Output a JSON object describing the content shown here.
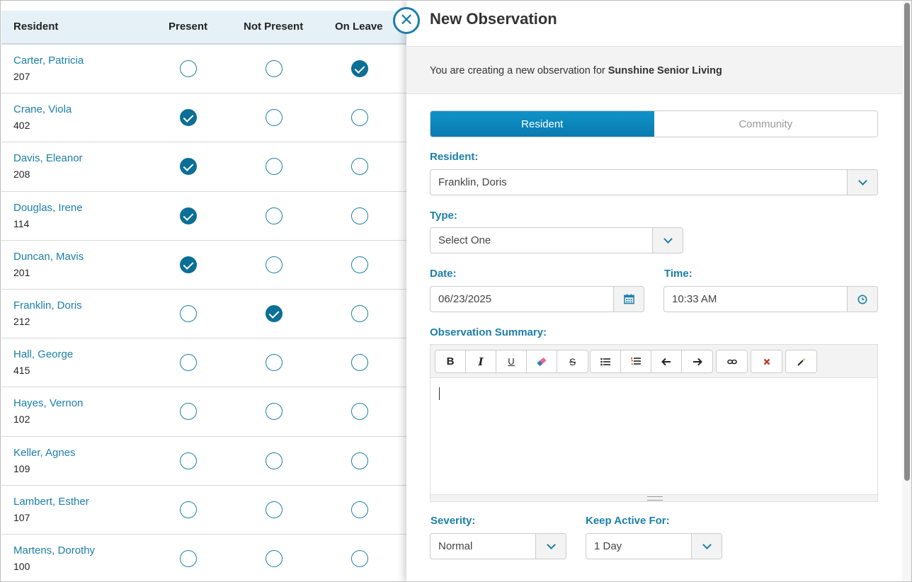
{
  "table": {
    "headers": {
      "resident": "Resident",
      "present": "Present",
      "not_present": "Not Present",
      "on_leave": "On Leave"
    },
    "rows": [
      {
        "name": "Carter, Patricia",
        "room": "207",
        "status": "on_leave"
      },
      {
        "name": "Crane, Viola",
        "room": "402",
        "status": "present"
      },
      {
        "name": "Davis, Eleanor",
        "room": "208",
        "status": "present"
      },
      {
        "name": "Douglas, Irene",
        "room": "114",
        "status": "present"
      },
      {
        "name": "Duncan, Mavis",
        "room": "201",
        "status": "present"
      },
      {
        "name": "Franklin, Doris",
        "room": "212",
        "status": "not_present"
      },
      {
        "name": "Hall, George",
        "room": "415",
        "status": "none"
      },
      {
        "name": "Hayes, Vernon",
        "room": "102",
        "status": "none"
      },
      {
        "name": "Keller, Agnes",
        "room": "109",
        "status": "none"
      },
      {
        "name": "Lambert, Esther",
        "room": "107",
        "status": "none"
      },
      {
        "name": "Martens, Dorothy",
        "room": "100",
        "status": "none"
      }
    ]
  },
  "panel": {
    "title": "New Observation",
    "info_prefix": "You are creating a new observation for ",
    "community_name": "Sunshine Senior Living",
    "tabs": {
      "resident": "Resident",
      "community": "Community",
      "selected": "Resident"
    },
    "resident_label": "Resident:",
    "resident_value": "Franklin, Doris",
    "type_label": "Type:",
    "type_value": "Select One",
    "date_label": "Date:",
    "date_value": "06/23/2025",
    "time_label": "Time:",
    "time_value": "10:33 AM",
    "summary_label": "Observation Summary:",
    "severity_label": "Severity:",
    "severity_value": "Normal",
    "keep_label": "Keep Active For:",
    "keep_value": "1 Day"
  },
  "toolbar": {
    "bold": "B",
    "italic": "I",
    "underline": "U",
    "strike": "S",
    "icons": [
      "bold-icon",
      "italic-icon",
      "underline-icon",
      "eraser-icon",
      "strikethrough-icon",
      "bullet-list-icon",
      "numbered-list-icon",
      "outdent-icon",
      "indent-icon",
      "link-icon",
      "remove-format-icon",
      "magic-wand-icon"
    ]
  },
  "colors": {
    "accent": "#1b7fa8",
    "tab_active": "#0a7bb0",
    "header_bg": "#e5f1f7",
    "info_bg": "#f3f3f3"
  }
}
